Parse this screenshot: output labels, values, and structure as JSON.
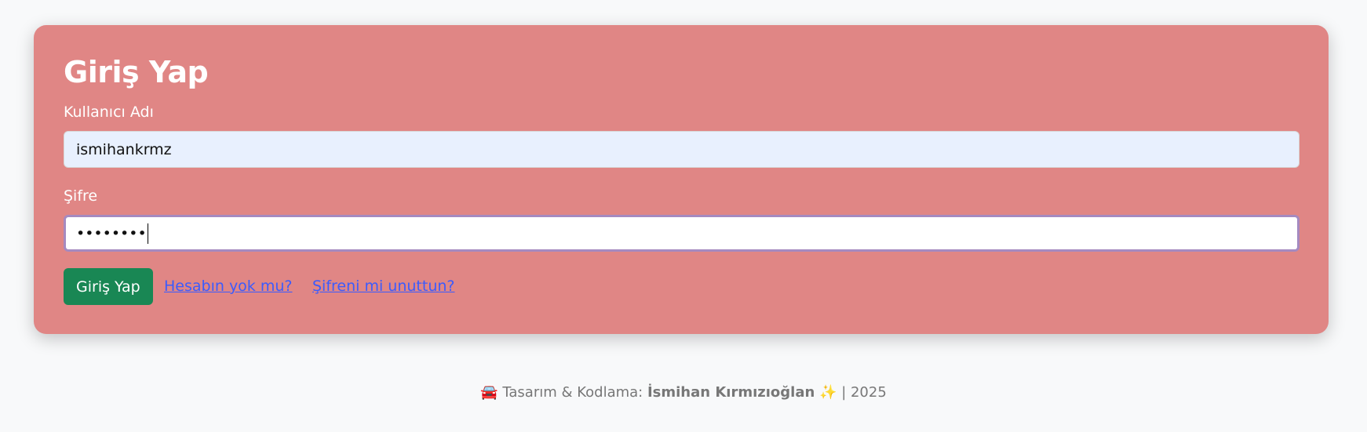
{
  "login": {
    "title": "Giriş Yap",
    "username_label": "Kullanıcı Adı",
    "username_value": "ismihankrmz",
    "password_label": "Şifre",
    "password_value": "••••••••",
    "submit_label": "Giriş Yap",
    "signup_link": "Hesabın yok mu?",
    "forgot_link": "Şifreni mi unuttun?"
  },
  "footer": {
    "car_emoji": "🚘",
    "prefix": "Tasarım & Kodlama:",
    "author": "İsmihan Kırmızıoğlan",
    "sparkle_emoji": "✨",
    "year": "| 2025"
  },
  "colors": {
    "card_bg": "#e08685",
    "button_bg": "#198754",
    "link": "#3b5bfd",
    "focus_border": "#a58ac0"
  }
}
